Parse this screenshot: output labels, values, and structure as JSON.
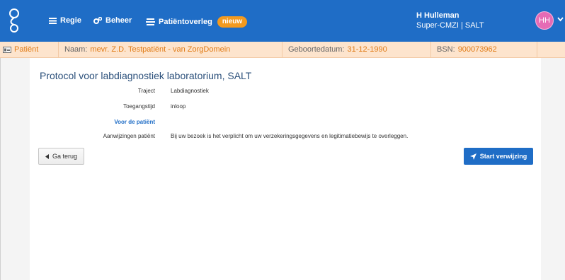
{
  "nav": {
    "regie": "Regie",
    "beheer": "Beheer",
    "patientoverleg": "Patiëntoverleg",
    "badge": "nieuw"
  },
  "user": {
    "name": "H Hulleman",
    "role": "Super-CMZI | SALT",
    "initials": "HH"
  },
  "patient_bar": {
    "tab": "Patiënt",
    "name_label": "Naam:",
    "name_value": "mevr. Z.D. Testpatiënt - van ZorgDomein",
    "dob_label": "Geboortedatum:",
    "dob_value": "31-12-1990",
    "bsn_label": "BSN:",
    "bsn_value": "900073962"
  },
  "page": {
    "title": "Protocol voor labdiagnostiek laboratorium, SALT",
    "fields": [
      {
        "label": "Traject",
        "value": "Labdiagnostiek"
      },
      {
        "label": "Toegangstijd",
        "value": "inloop"
      }
    ],
    "section_heading": "Voor de patiënt",
    "instructions_label": "Aanwijzingen patiënt",
    "instructions_value": "Bij uw bezoek is het verplicht om uw verzekeringsgegevens en legitimatiebewijs te overleggen."
  },
  "buttons": {
    "back": "Ga terug",
    "start": "Start verwijzing"
  },
  "colors": {
    "primary": "#1f6dc6",
    "accent": "#f39a1f",
    "patient_bar_bg": "#fde4cd",
    "avatar": "#e66bb5"
  }
}
